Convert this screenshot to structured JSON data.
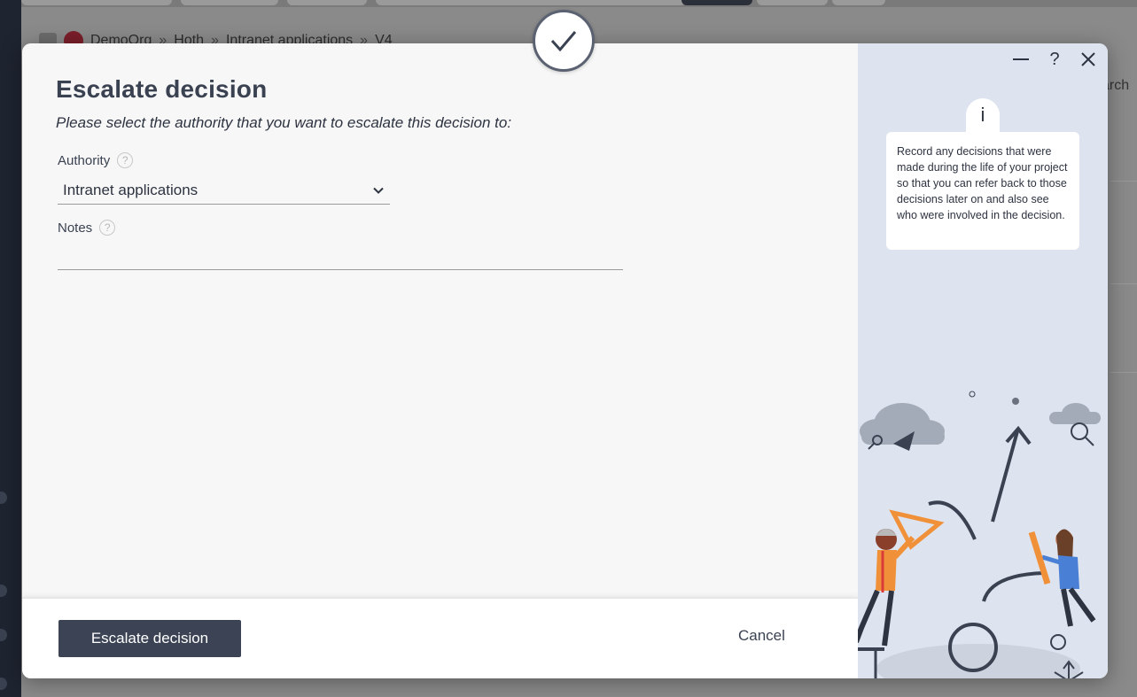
{
  "background": {
    "breadcrumbs": [
      "DemoOrg",
      "Hoth",
      "Intranet applications",
      "V4"
    ],
    "search_partial": "arch"
  },
  "dialog": {
    "title": "Escalate decision",
    "subtitle": "Please select the authority that you want to escalate this decision to:",
    "authority": {
      "label": "Authority",
      "help": "?",
      "value": "Intranet applications"
    },
    "notes": {
      "label": "Notes",
      "help": "?",
      "value": ""
    },
    "primary_button": "Escalate decision",
    "cancel_button": "Cancel"
  },
  "help_pane": {
    "controls": {
      "minimize": "—",
      "help": "?",
      "close": "✕"
    },
    "info_icon": "i",
    "info_text": "Record any decisions that were made during the life of your project so that you can refer back to those decisions later on and also see who were involved in the decision."
  },
  "colors": {
    "primary": "#3b4354",
    "side_pane": "#dde4ef",
    "accent_orange": "#f0913a",
    "accent_blue": "#4a7fd6"
  }
}
